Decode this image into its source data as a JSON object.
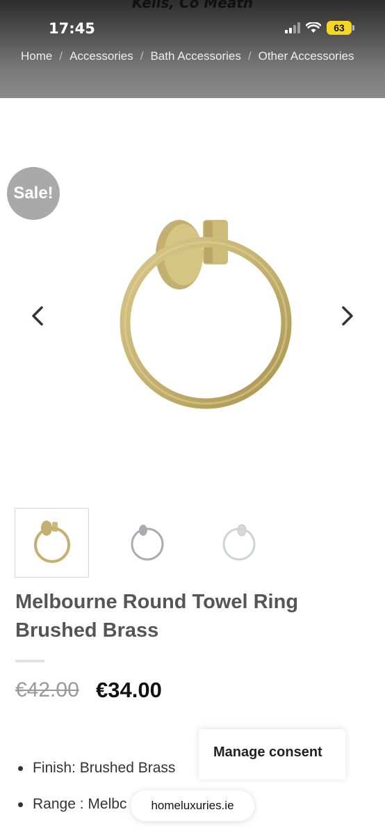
{
  "header": {
    "store_banner": "Kells, Co Meath",
    "status": {
      "time": "17:45",
      "battery": "63"
    },
    "breadcrumb": [
      "Home",
      "Accessories",
      "Bath Accessories",
      "Other Accessories"
    ]
  },
  "product": {
    "badge": "Sale!",
    "title": "Melbourne Round Towel Ring Brushed Brass",
    "price_old": "€42.00",
    "price_new": "€34.00",
    "thumbnails": [
      "brushed-brass",
      "brushed-nickel",
      "chrome"
    ],
    "specs": [
      {
        "label": "Finish:",
        "value": "Brushed Brass"
      },
      {
        "label": "Range :",
        "value": "Melbc"
      }
    ]
  },
  "consent": {
    "label": "Manage consent"
  },
  "browser": {
    "url": "homeluxuries.ie"
  },
  "colors": {
    "brass": "#c9b777",
    "nickel": "#a9adb1",
    "chrome": "#d7d9db"
  }
}
